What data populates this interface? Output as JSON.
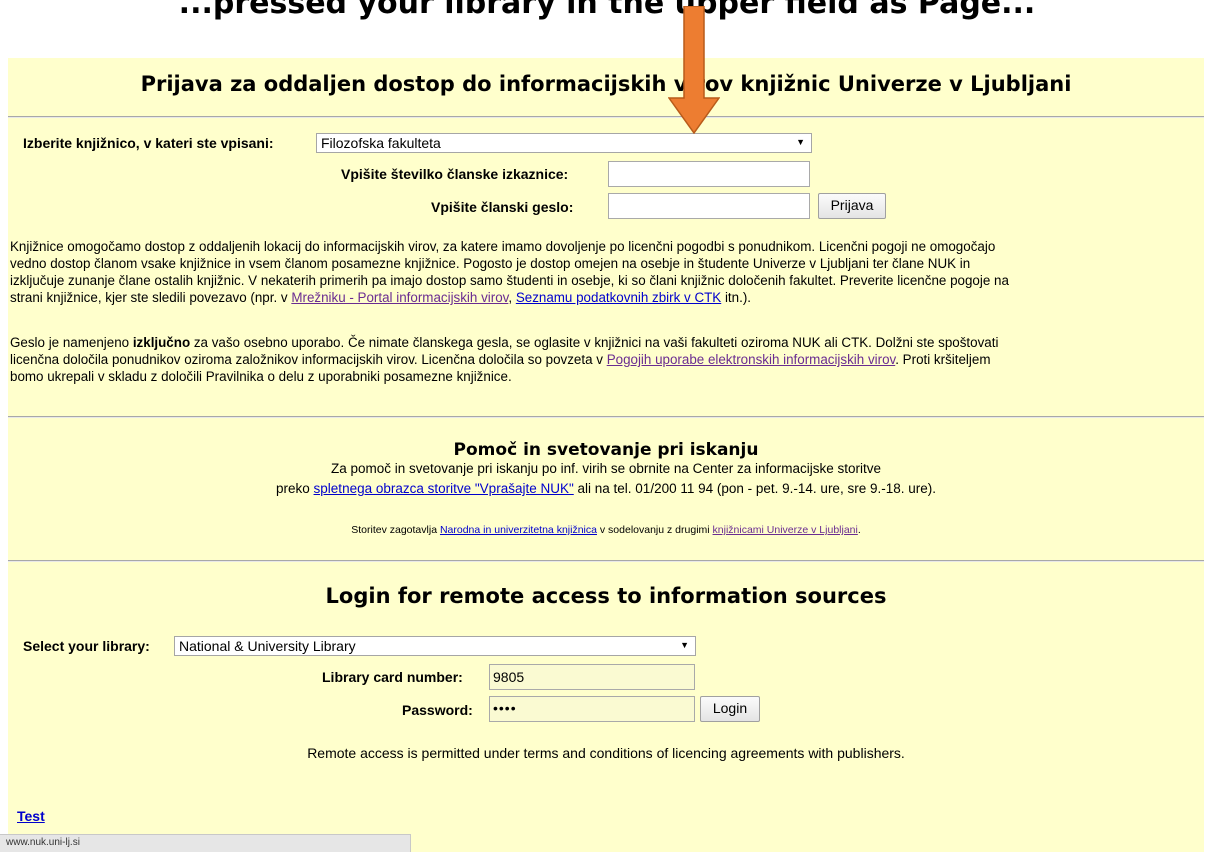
{
  "caption": "...pressed your library in the upper field as Page...",
  "si": {
    "title": "Prijava za oddaljen dostop do informacijskih virov knjižnic Univerze v Ljubljani",
    "library_label": "Izberite knjižnico, v kateri ste vpisani:",
    "library_value": "Filozofska fakulteta",
    "card_label": "Vpišite številko članske izkaznice:",
    "card_value": "",
    "password_label": "Vpišite članski geslo:",
    "password_value": "",
    "login_button": "Prijava",
    "p1": {
      "l1": "Knjižnice omogočamo dostop z oddaljenih lokacij do informacijskih virov, za katere imamo dovoljenje po licenčni pogodbi s ponudnikom. Licenčni pogoji ne omogočajo",
      "l2": "vedno dostop članom vsake knjižnice in vsem članom posamezne knjižnice. Pogosto je dostop omejen na osebje in študente Univerze v Ljubljani ter člane NUK in",
      "l3": "izključuje zunanje člane ostalih knjižnic. V nekaterih primerih pa imajo dostop samo študenti in osebje, ki so člani knjižnic določenih fakultet. Preverite licenčne pogoje na",
      "l4_pre": "strani knjižnice, kjer ste sledili povezavo (npr. v ",
      "link_mreznik": "Mrežniku - Portal informacijskih virov",
      "sep": ", ",
      "link_ctk": "Seznamu podatkovnih zbirk v CTK",
      "l4_post": " itn.)."
    },
    "p2": {
      "l1_pre": "Geslo je namenjeno ",
      "l1_bold": "izključno",
      "l1_post": " za vašo osebno uporabo. Če nimate članskega gesla, se oglasite v knjižnici na vaši fakulteti oziroma NUK ali CTK. Dolžni ste spoštovati",
      "l2_pre": "licenčna določila ponudnikov oziroma založnikov informacijskih virov. Licenčna določila so povzeta v ",
      "link_pogoji": "Pogojih uporabe elektronskih informacijskih virov",
      "l2_post": ". Proti kršiteljem",
      "l3": "bomo ukrepali v skladu z določili Pravilnika o delu z uporabniki posamezne knjižnice."
    },
    "help": {
      "title": "Pomoč in svetovanje pri iskanju",
      "l1": "Za pomoč in svetovanje pri iskanju po inf. virih se obrnite na Center za informacijske storitve",
      "l2_pre": "preko ",
      "link_form": "spletnega obrazca storitve \"Vprašajte NUK\"",
      "l2_post": " ali na tel. 01/200 11 94 (pon - pet. 9.-14. ure, sre 9.-18. ure)."
    },
    "credits": {
      "pre": "Storitev zagotavlja ",
      "link_nuk": "Narodna in univerzitetna knjižnica",
      "mid": "  v sodelovanju z drugimi ",
      "link_libs": "knjižnicami Univerze v Ljubljani",
      "post": "."
    }
  },
  "en": {
    "title": "Login for remote access to information sources",
    "library_label": "Select your library:",
    "library_value": "National & University Library",
    "card_label": "Library card number:",
    "card_value": "9805",
    "password_label": "Password:",
    "password_value": "••••",
    "login_button": "Login",
    "note": "Remote access is permitted under terms and conditions of licencing agreements with publishers."
  },
  "test_link": "Test",
  "status_url": "www.nuk.uni-lj.si",
  "colors": {
    "page_bg": "#ffffcc",
    "arrow": "#ed7d31",
    "link": "#0000cc",
    "visited": "#6a2c91"
  }
}
